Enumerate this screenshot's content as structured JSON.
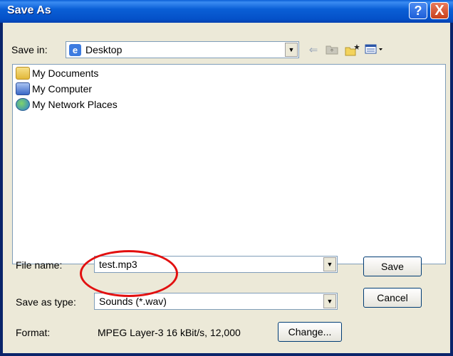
{
  "dialog": {
    "title": "Save As",
    "help_glyph": "?",
    "close_glyph": "X"
  },
  "save_in": {
    "label": "Save in:",
    "value": "Desktop",
    "icon": "desktop-icon"
  },
  "toolbar": {
    "back_icon": "back-arrow-icon",
    "up_icon": "up-folder-icon",
    "new_folder_icon": "new-folder-icon",
    "views_icon": "views-menu-icon"
  },
  "files": [
    {
      "label": "My Documents",
      "icon": "my-documents-icon"
    },
    {
      "label": "My Computer",
      "icon": "my-computer-icon"
    },
    {
      "label": "My Network Places",
      "icon": "my-network-places-icon"
    }
  ],
  "file_name": {
    "label": "File name:",
    "value": "test.mp3"
  },
  "save_as_type": {
    "label": "Save as type:",
    "value": "Sounds (*.wav)"
  },
  "format": {
    "label": "Format:",
    "value": "MPEG Layer-3 16 kBit/s, 12,000"
  },
  "buttons": {
    "save": "Save",
    "cancel": "Cancel",
    "change": "Change..."
  },
  "colors": {
    "title_bar": "#0a5fd6",
    "callout": "#e21010"
  }
}
